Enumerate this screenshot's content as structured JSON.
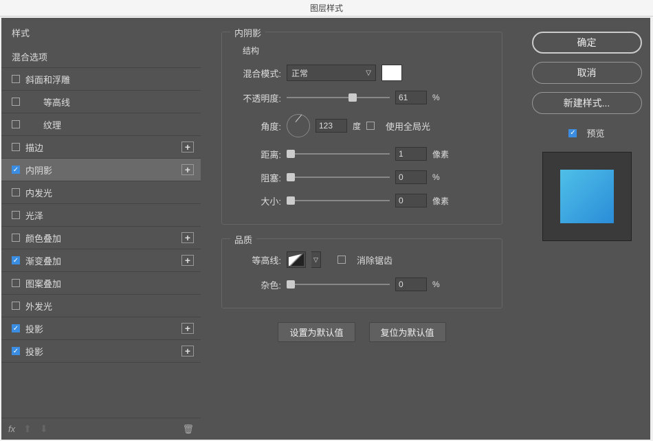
{
  "window_title": "图层样式",
  "left": {
    "header": "样式",
    "blend_options": "混合选项",
    "items": [
      {
        "label": "斜面和浮雕",
        "checked": false,
        "add": false
      },
      {
        "label": "等高线",
        "checked": false,
        "indent": true,
        "add": false
      },
      {
        "label": "纹理",
        "checked": false,
        "indent": true,
        "add": false
      },
      {
        "label": "描边",
        "checked": false,
        "add": true
      },
      {
        "label": "内阴影",
        "checked": true,
        "selected": true,
        "add": true
      },
      {
        "label": "内发光",
        "checked": false,
        "add": false
      },
      {
        "label": "光泽",
        "checked": false,
        "add": false
      },
      {
        "label": "颜色叠加",
        "checked": false,
        "add": true
      },
      {
        "label": "渐变叠加",
        "checked": true,
        "add": true
      },
      {
        "label": "图案叠加",
        "checked": false,
        "add": false
      },
      {
        "label": "外发光",
        "checked": false,
        "add": false
      },
      {
        "label": "投影",
        "checked": true,
        "add": true
      },
      {
        "label": "投影",
        "checked": true,
        "add": true
      }
    ],
    "fx_label": "fx"
  },
  "center": {
    "panel_title": "内阴影",
    "structure_label": "结构",
    "blend_mode_label": "混合模式:",
    "blend_mode_value": "正常",
    "opacity_label": "不透明度:",
    "opacity_value": "61",
    "opacity_unit": "%",
    "angle_label": "角度:",
    "angle_value": "123",
    "angle_unit": "度",
    "global_light_label": "使用全局光",
    "global_light_checked": false,
    "distance_label": "距离:",
    "distance_value": "1",
    "distance_unit": "像素",
    "choke_label": "阻塞:",
    "choke_value": "0",
    "choke_unit": "%",
    "size_label": "大小:",
    "size_value": "0",
    "size_unit": "像素",
    "quality_title": "品质",
    "contour_label": "等高线:",
    "antialias_label": "消除锯齿",
    "antialias_checked": false,
    "noise_label": "杂色:",
    "noise_value": "0",
    "noise_unit": "%",
    "btn_default": "设置为默认值",
    "btn_reset": "复位为默认值"
  },
  "right": {
    "ok": "确定",
    "cancel": "取消",
    "new_style": "新建样式...",
    "preview_label": "预览",
    "preview_checked": true
  }
}
